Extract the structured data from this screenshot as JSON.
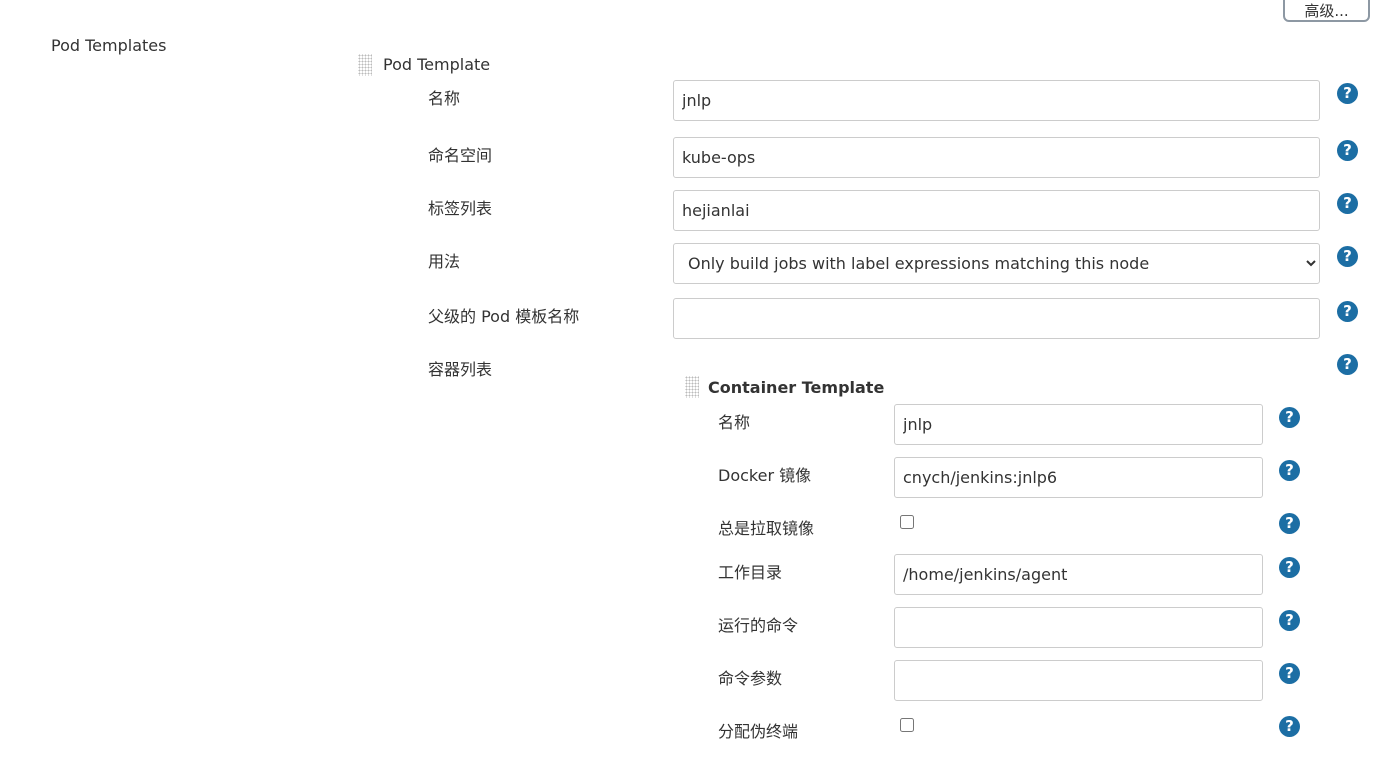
{
  "advanced_button": "高级...",
  "section_label": "Pod Templates",
  "pod_template": {
    "title": "Pod Template",
    "fields": [
      {
        "label": "名称",
        "value": "jnlp"
      },
      {
        "label": "命名空间",
        "value": "kube-ops"
      },
      {
        "label": "标签列表",
        "value": "hejianlai"
      },
      {
        "label": "用法",
        "value": "Only build jobs with label expressions matching this node"
      },
      {
        "label": "父级的 Pod 模板名称",
        "value": ""
      },
      {
        "label": "容器列表"
      }
    ]
  },
  "container_template": {
    "title": "Container Template",
    "fields": [
      {
        "label": "名称",
        "value": "jnlp"
      },
      {
        "label": "Docker 镜像",
        "value": "cnych/jenkins:jnlp6"
      },
      {
        "label": "总是拉取镜像",
        "checked": false
      },
      {
        "label": "工作目录",
        "value": "/home/jenkins/agent"
      },
      {
        "label": "运行的命令",
        "value": ""
      },
      {
        "label": "命令参数",
        "value": ""
      },
      {
        "label": "分配伪终端",
        "checked": false
      }
    ]
  },
  "help_glyph": "?"
}
